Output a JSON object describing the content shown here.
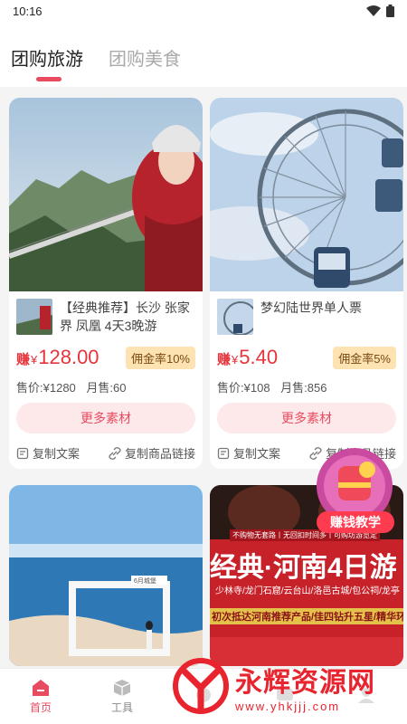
{
  "status": {
    "time": "10:16"
  },
  "tabs": [
    {
      "label": "团购旅游",
      "active": true
    },
    {
      "label": "团购美食",
      "active": false
    }
  ],
  "products": [
    {
      "title": "【经典推荐】长沙 张家界 凤凰 4天3晚游",
      "earn_label": "赚",
      "currency": "¥",
      "earn": "128.00",
      "commission": "佣金率10%",
      "price_label": "售价:",
      "price": "¥1280",
      "monthly_label": "月售:",
      "monthly": "60",
      "more_label": "更多素材",
      "copy_text": "复制文案",
      "copy_link": "复制商品链接"
    },
    {
      "title": "梦幻陆世界单人票",
      "earn_label": "赚",
      "currency": "¥",
      "earn": "5.40",
      "commission": "佣金率5%",
      "price_label": "售价:",
      "price": "¥108",
      "monthly_label": "月售:",
      "monthly": "856",
      "more_label": "更多素材",
      "copy_text": "复制文案",
      "copy_link": "复制商品链接"
    }
  ],
  "card4_poster": {
    "warn": "不购物无套路丨无回扣时间多丨可购坊游览定",
    "headline": "经典·河南4日游",
    "places": "少林寺/龙门石窟/云台山/洛邑古城/包公祠/龙亭",
    "bottom": "初次抵达河南推荐产品/佳四钻升五星/精华环游"
  },
  "card3_sign": "6月城堡",
  "float_badge": {
    "label": "赚钱教学"
  },
  "bottom_nav": [
    {
      "label": "首页",
      "icon": "home-icon",
      "active": true
    },
    {
      "label": "工具",
      "icon": "cube-icon",
      "active": false
    },
    {
      "label": "",
      "icon": "center-icon",
      "active": false
    },
    {
      "label": "",
      "icon": "message-icon",
      "active": false
    },
    {
      "label": "",
      "icon": "user-icon",
      "active": false
    }
  ],
  "watermark": {
    "main": "永辉资源网",
    "url": "www.yhkjjj.com"
  },
  "colors": {
    "accent": "#e84a5f",
    "price": "#e6343c",
    "commission_bg": "#fde3b2",
    "button_bg": "#fde8ea"
  }
}
